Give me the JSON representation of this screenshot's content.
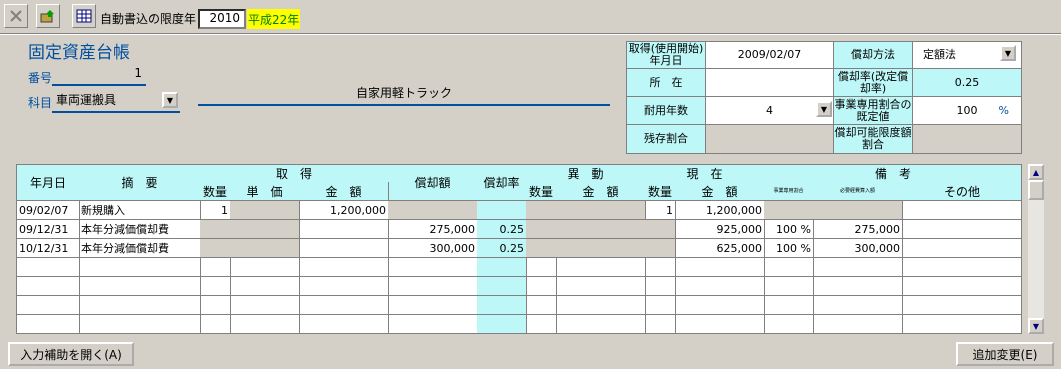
{
  "toolbar": {
    "autoinsert_label": "自動書込の限度年",
    "autoinsert_year": "2010",
    "autoinsert_era": "平成22年"
  },
  "title": "固定資産台帳",
  "form": {
    "number_label": "番号",
    "number_value": "1",
    "subject_label": "科目",
    "subject_value": "車両運搬具",
    "description": "自家用軽トラック"
  },
  "info": {
    "acq_date_label": "取得(使用開始)年月日",
    "acq_date_value": "2009/02/07",
    "method_label": "償却方法",
    "method_value": "定額法",
    "location_label": "所　在",
    "location_value": "",
    "rate_label": "償却率(改定償却率)",
    "rate_value": "0.25",
    "life_label": "耐用年数",
    "life_value": "4",
    "business_label": "事業専用割合の既定値",
    "business_value": "100",
    "business_unit": "%",
    "residual_label": "残存割合",
    "residual_value": "",
    "limit_label": "償却可能限度額割合",
    "limit_value": ""
  },
  "table": {
    "headers": {
      "date": "年月日",
      "summary": "摘　要",
      "acquisition": "取　得",
      "qty1": "数量",
      "unit_price": "単　価",
      "amount1": "金　額",
      "depreciation": "償却額",
      "dep_rate": "償却率",
      "change": "異　動",
      "qty2": "数量",
      "amount2": "金　額",
      "current": "現　在",
      "qty3": "数量",
      "amount3": "金　額",
      "remarks": "備　考",
      "biz_ratio": "事業専用割合",
      "necessary_exp": "必要経費算入額",
      "other": "その他"
    },
    "rows": [
      {
        "date": "09/02/07",
        "summary": "新規購入",
        "qty1": "1",
        "unit_price": "",
        "amount1": "1,200,000",
        "dep": "",
        "rate": "",
        "qty2": "",
        "amt2": "",
        "qty3": "1",
        "amt3": "1,200,000",
        "biz": "",
        "necessary": "",
        "other": ""
      },
      {
        "date": "09/12/31",
        "summary": "本年分減価償却費",
        "qty1": "",
        "unit_price": "",
        "amount1": "",
        "dep": "275,000",
        "rate": "0.25",
        "qty2": "",
        "amt2": "",
        "qty3": "",
        "amt3": "925,000",
        "biz": "100 %",
        "necessary": "275,000",
        "other": ""
      },
      {
        "date": "10/12/31",
        "summary": "本年分減価償却費",
        "qty1": "",
        "unit_price": "",
        "amount1": "",
        "dep": "300,000",
        "rate": "0.25",
        "qty2": "",
        "amt2": "",
        "qty3": "",
        "amt3": "625,000",
        "biz": "100 %",
        "necessary": "300,000",
        "other": ""
      }
    ]
  },
  "buttons": {
    "open_assist": "入力補助を開く(A)",
    "add_change": "追加変更(E)"
  },
  "colors": {
    "accent": "#bdf7f7",
    "era_highlight": "#ffff00",
    "title": "#0050a0"
  }
}
